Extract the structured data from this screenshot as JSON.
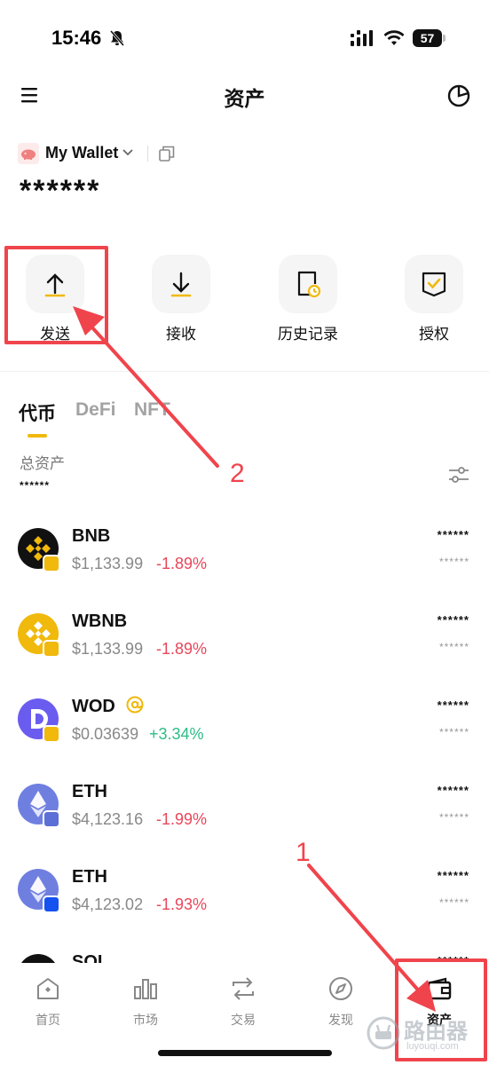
{
  "status": {
    "time": "15:46",
    "battery": "57"
  },
  "header": {
    "title": "资产"
  },
  "wallet": {
    "name": "My Wallet",
    "balance": "******"
  },
  "actions": [
    {
      "label": "发送",
      "icon": "arrow-up-icon"
    },
    {
      "label": "接收",
      "icon": "arrow-down-icon"
    },
    {
      "label": "历史记录",
      "icon": "history-icon"
    },
    {
      "label": "授权",
      "icon": "authorize-icon"
    }
  ],
  "tabs": [
    {
      "label": "代币"
    },
    {
      "label": "DeFi"
    },
    {
      "label": "NFT"
    }
  ],
  "total": {
    "label": "总资产",
    "value": "******"
  },
  "tokens": [
    {
      "symbol": "BNB",
      "price": "$1,133.99",
      "change": "-1.89%",
      "amount": "******",
      "value": "******",
      "logo": "bnb-logo-icon"
    },
    {
      "symbol": "WBNB",
      "price": "$1,133.99",
      "change": "-1.89%",
      "amount": "******",
      "value": "******",
      "logo": "wbnb-logo-icon"
    },
    {
      "symbol": "WOD",
      "price": "$0.03639",
      "change": "+3.34%",
      "amount": "******",
      "value": "******",
      "logo": "wod-logo-icon"
    },
    {
      "symbol": "ETH",
      "price": "$4,123.16",
      "change": "-1.99%",
      "amount": "******",
      "value": "******",
      "logo": "eth-logo-icon"
    },
    {
      "symbol": "ETH",
      "price": "$4,123.02",
      "change": "-1.93%",
      "amount": "******",
      "value": "******",
      "logo": "eth-logo-icon"
    },
    {
      "symbol": "SOL",
      "amount": "******",
      "logo": "sol-logo-icon"
    }
  ],
  "tabbar": [
    {
      "label": "首页",
      "icon": "home-icon"
    },
    {
      "label": "市场",
      "icon": "market-icon"
    },
    {
      "label": "交易",
      "icon": "swap-icon"
    },
    {
      "label": "发现",
      "icon": "compass-icon"
    },
    {
      "label": "资产",
      "icon": "wallet-icon"
    }
  ],
  "annotations": {
    "step1": "1",
    "step2": "2"
  },
  "watermark": {
    "title": "路由器",
    "subtitle": "luyouqi.com"
  },
  "colors": {
    "accent": "#f0b90b",
    "negative": "#e8465a",
    "positive": "#2ebd85",
    "annotation": "#f0444c"
  }
}
